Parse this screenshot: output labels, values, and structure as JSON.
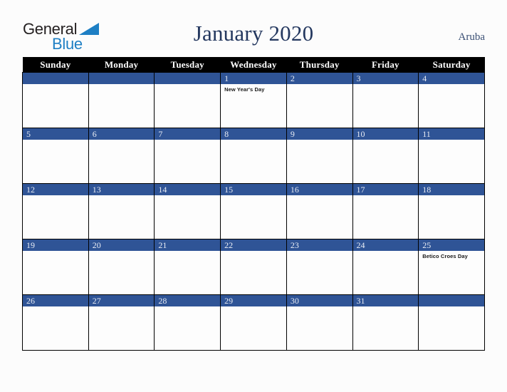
{
  "brand": {
    "name_part1": "General",
    "name_part2": "Blue",
    "triangle_icon": "triangle-icon",
    "color_dark": "#231f20",
    "color_blue": "#1e7fc4"
  },
  "header": {
    "title": "January 2020",
    "region": "Aruba",
    "title_color": "#24385f"
  },
  "calendar": {
    "month": "January",
    "year": "2020",
    "accent_color": "#2f5496",
    "header_bg": "#000000",
    "weekday_headers": [
      "Sunday",
      "Monday",
      "Tuesday",
      "Wednesday",
      "Thursday",
      "Friday",
      "Saturday"
    ],
    "weeks": [
      [
        {
          "day": "",
          "event": ""
        },
        {
          "day": "",
          "event": ""
        },
        {
          "day": "",
          "event": ""
        },
        {
          "day": "1",
          "event": "New Year's Day"
        },
        {
          "day": "2",
          "event": ""
        },
        {
          "day": "3",
          "event": ""
        },
        {
          "day": "4",
          "event": ""
        }
      ],
      [
        {
          "day": "5",
          "event": ""
        },
        {
          "day": "6",
          "event": ""
        },
        {
          "day": "7",
          "event": ""
        },
        {
          "day": "8",
          "event": ""
        },
        {
          "day": "9",
          "event": ""
        },
        {
          "day": "10",
          "event": ""
        },
        {
          "day": "11",
          "event": ""
        }
      ],
      [
        {
          "day": "12",
          "event": ""
        },
        {
          "day": "13",
          "event": ""
        },
        {
          "day": "14",
          "event": ""
        },
        {
          "day": "15",
          "event": ""
        },
        {
          "day": "16",
          "event": ""
        },
        {
          "day": "17",
          "event": ""
        },
        {
          "day": "18",
          "event": ""
        }
      ],
      [
        {
          "day": "19",
          "event": ""
        },
        {
          "day": "20",
          "event": ""
        },
        {
          "day": "21",
          "event": ""
        },
        {
          "day": "22",
          "event": ""
        },
        {
          "day": "23",
          "event": ""
        },
        {
          "day": "24",
          "event": ""
        },
        {
          "day": "25",
          "event": "Betico Croes Day"
        }
      ],
      [
        {
          "day": "26",
          "event": ""
        },
        {
          "day": "27",
          "event": ""
        },
        {
          "day": "28",
          "event": ""
        },
        {
          "day": "29",
          "event": ""
        },
        {
          "day": "30",
          "event": ""
        },
        {
          "day": "31",
          "event": ""
        },
        {
          "day": "",
          "event": ""
        }
      ]
    ]
  }
}
